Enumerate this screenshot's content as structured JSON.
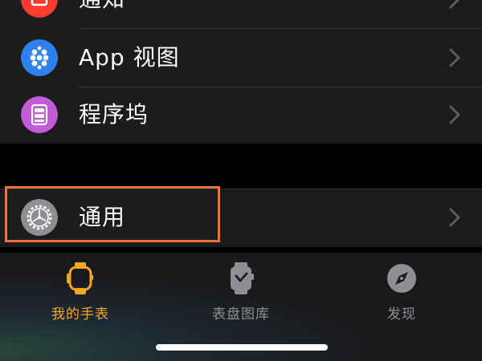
{
  "settings": {
    "rows": [
      {
        "label": "通知",
        "icon": "notification-icon",
        "color": "#ff3b30"
      },
      {
        "label": "App 视图",
        "icon": "app-view-icon",
        "color": "#2f80ed"
      },
      {
        "label": "程序坞",
        "icon": "dock-icon",
        "color": "#c45bd6"
      },
      {
        "label": "通用",
        "icon": "gear-icon",
        "color": "#8e8e93"
      }
    ],
    "highlighted_row": "通用"
  },
  "tabbar": {
    "tabs": [
      {
        "label": "我的手表",
        "icon": "my-watch-icon",
        "active": true
      },
      {
        "label": "表盘图库",
        "icon": "watch-face-gallery-icon",
        "active": false
      },
      {
        "label": "发现",
        "icon": "compass-icon",
        "active": false
      }
    ],
    "active_color": "#f5a623",
    "inactive_color": "#8e8e93"
  }
}
